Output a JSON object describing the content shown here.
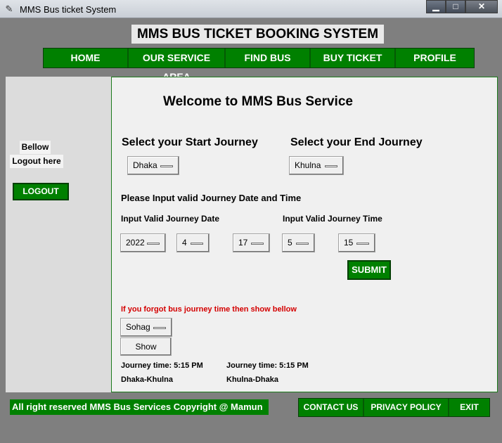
{
  "window": {
    "title": "MMS Bus ticket System",
    "icon": "feather-icon"
  },
  "header": {
    "title": "MMS BUS TICKET BOOKING SYSTEM"
  },
  "nav": {
    "items": [
      "HOME",
      "OUR SERVICE AREA",
      "FIND BUS",
      "BUY TICKET",
      "PROFILE"
    ]
  },
  "sidebar": {
    "bellow_label": "Bellow",
    "logout_label": "Logout here",
    "logout_button": "LOGOUT"
  },
  "main": {
    "welcome": "Welcome to MMS Bus Service",
    "start_label": "Select your Start Journey",
    "end_label": "Select your End Journey",
    "start_value": "Dhaka",
    "end_value": "Khulna",
    "date_time_heading": "Please Input valid Journey Date and Time",
    "date_label": "Input Valid Journey Date",
    "time_label": "Input Valid Journey Time",
    "year": "2022",
    "month": "4",
    "day": "17",
    "hour": "5",
    "minute": "15",
    "submit": "SUBMIT",
    "forgot_text": "If you forgot bus journey time then show bellow",
    "bus_select": "Sohag",
    "show_button": "Show",
    "journey1_time": "Journey time: 5:15 PM",
    "journey1_route": "Dhaka-Khulna",
    "journey2_time": "Journey time: 5:15 PM",
    "journey2_route": "Khulna-Dhaka"
  },
  "footer": {
    "copyright": "All right reserved MMS Bus Services Copyright @ Mamun",
    "links": [
      "CONTACT US",
      "PRIVACY POLICY",
      "EXIT"
    ]
  },
  "colors": {
    "accent_green": "#008000",
    "frame_gray": "#7f7f7f",
    "warning_red": "#d40000"
  }
}
